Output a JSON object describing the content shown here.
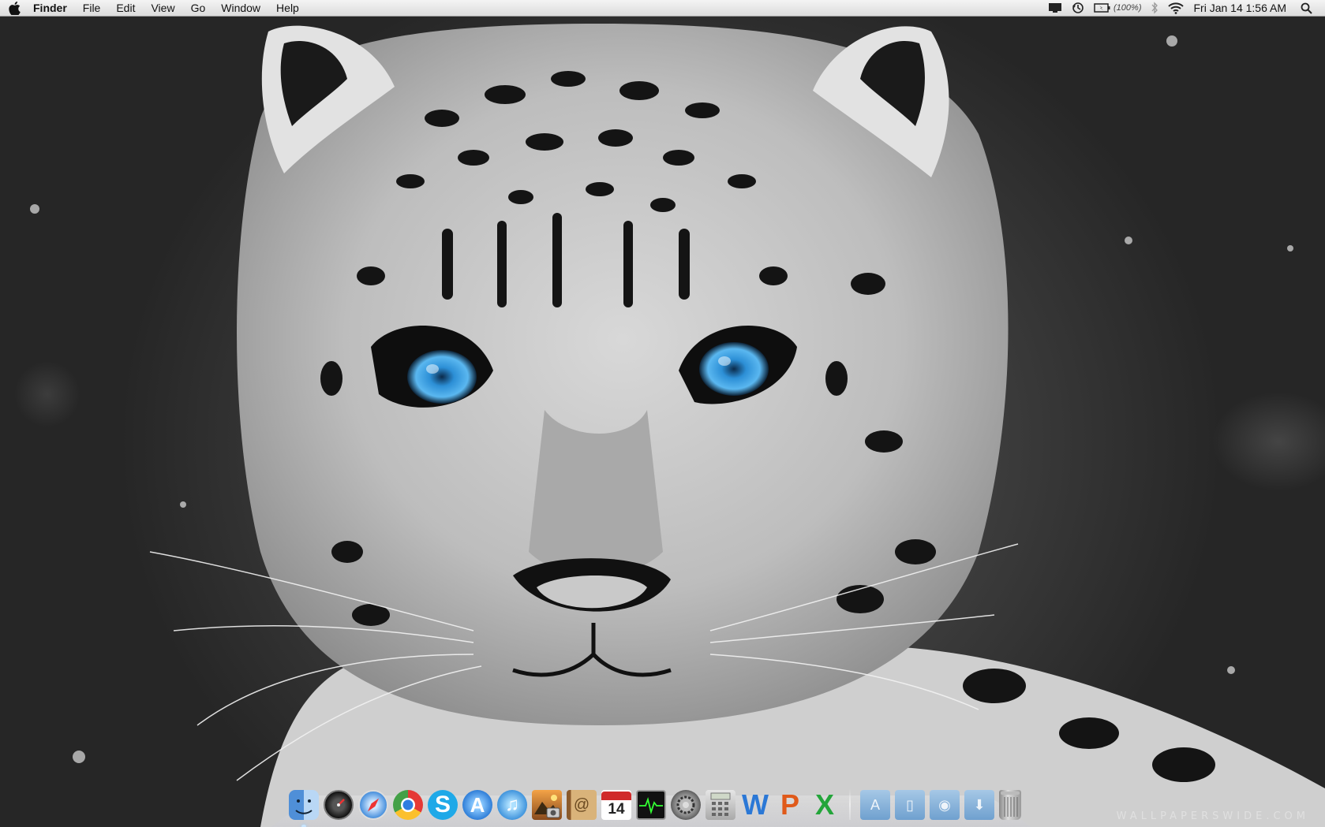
{
  "menubar": {
    "apple_menu_icon": "apple-icon",
    "app_name": "Finder",
    "menus": [
      "File",
      "Edit",
      "View",
      "Go",
      "Window",
      "Help"
    ],
    "status_icons": [
      "display-mirroring-icon",
      "time-machine-icon",
      "battery-icon",
      "bluetooth-icon",
      "wifi-icon",
      "spotlight-icon"
    ],
    "battery_percent": "(100%)",
    "clock": "Fri Jan 14  1:56 AM"
  },
  "desktop": {
    "watermark": "WALLPAPERSWIDE.COM"
  },
  "dock": {
    "apps": [
      {
        "name": "finder-icon",
        "label": "",
        "running": true
      },
      {
        "name": "dashboard-icon",
        "label": ""
      },
      {
        "name": "safari-icon",
        "label": ""
      },
      {
        "name": "chrome-icon",
        "label": ""
      },
      {
        "name": "skype-icon",
        "label": "S"
      },
      {
        "name": "app-store-icon",
        "label": "A"
      },
      {
        "name": "itunes-icon",
        "label": "♫"
      },
      {
        "name": "iphoto-icon",
        "label": ""
      },
      {
        "name": "address-book-icon",
        "label": "@"
      },
      {
        "name": "ical-icon",
        "label": "14"
      },
      {
        "name": "activity-monitor-icon",
        "label": ""
      },
      {
        "name": "system-preferences-icon",
        "label": ""
      },
      {
        "name": "calculator-icon",
        "label": ""
      },
      {
        "name": "word-icon",
        "label": "W"
      },
      {
        "name": "powerpoint-icon",
        "label": "P"
      },
      {
        "name": "excel-icon",
        "label": "X"
      }
    ],
    "stacks": [
      {
        "name": "applications-folder-icon",
        "label": "A"
      },
      {
        "name": "documents-folder-icon",
        "label": "▯"
      },
      {
        "name": "pictures-folder-icon",
        "label": "◉"
      },
      {
        "name": "downloads-folder-icon",
        "label": "⬇"
      }
    ],
    "trash": {
      "name": "trash-icon"
    }
  }
}
